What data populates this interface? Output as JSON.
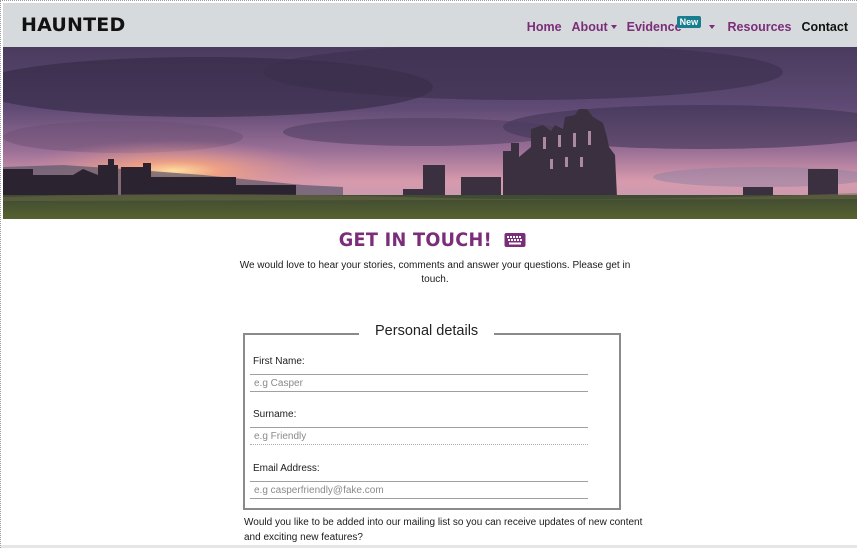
{
  "nav": {
    "brand": "HAUNTED",
    "items": [
      {
        "label": "Home"
      },
      {
        "label": "About"
      },
      {
        "label": "Evidence",
        "badge": "New"
      },
      {
        "label": "Resources"
      },
      {
        "label": "Contact"
      }
    ]
  },
  "hero": {
    "image_icon": "abbey-ruins-sunset-image"
  },
  "main": {
    "title": "GET IN TOUCH!",
    "title_icon": "keyboard-icon",
    "intro": "We would love to hear your stories, comments and answer your questions. Please get in touch."
  },
  "form": {
    "legend": "Personal details",
    "fields": [
      {
        "label": "First Name:",
        "placeholder": "e.g Casper"
      },
      {
        "label": "Surname:",
        "placeholder": "e.g Friendly"
      },
      {
        "label": "Email Address:",
        "placeholder": "e.g casperfriendly@fake.com"
      }
    ],
    "mailing_question": "Would you like to be added into our mailing list so you can receive updates of new content and exciting new features?"
  },
  "colors": {
    "accent": "#7b2d7a",
    "navbar_bg": "#d6dadc",
    "badge_bg": "#187d8f"
  }
}
